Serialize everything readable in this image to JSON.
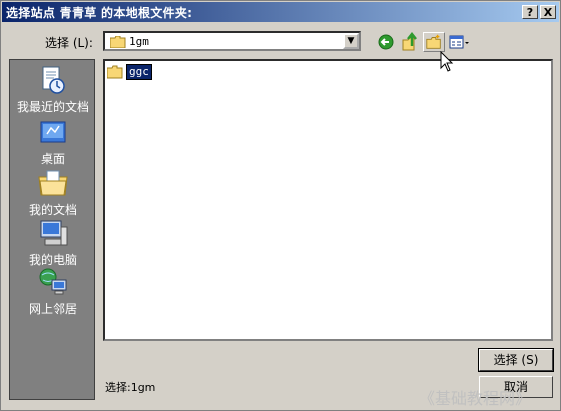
{
  "window": {
    "title": "选择站点 青青草 的本地根文件夹:",
    "help_label": "?",
    "close_label": "X"
  },
  "lookin": {
    "label": "选择 (L):",
    "value": "1gm",
    "drop_glyph": "▼"
  },
  "toolbar": {
    "back_icon": "back-arrow-icon",
    "up_icon": "up-folder-icon",
    "new_folder_icon": "new-folder-icon",
    "views_icon": "views-menu-icon"
  },
  "places": [
    {
      "label": "我最近的文档",
      "icon": "recent-documents-icon"
    },
    {
      "label": "桌面",
      "icon": "desktop-icon"
    },
    {
      "label": "我的文档",
      "icon": "my-documents-icon"
    },
    {
      "label": "我的电脑",
      "icon": "my-computer-icon"
    },
    {
      "label": "网上邻居",
      "icon": "network-places-icon"
    }
  ],
  "files": [
    {
      "name": "ggc",
      "selected": true
    }
  ],
  "footer": {
    "selection_text": "选择:1gm",
    "select_button": "选择 (S)",
    "cancel_button": "取消"
  },
  "watermark": "《基础教程网》",
  "colors": {
    "titlebar_start": "#0a246a",
    "titlebar_end": "#a6caf0",
    "dialog_bg": "#d4d0c8",
    "places_bg": "#808080",
    "selection_bg": "#0a246a"
  }
}
